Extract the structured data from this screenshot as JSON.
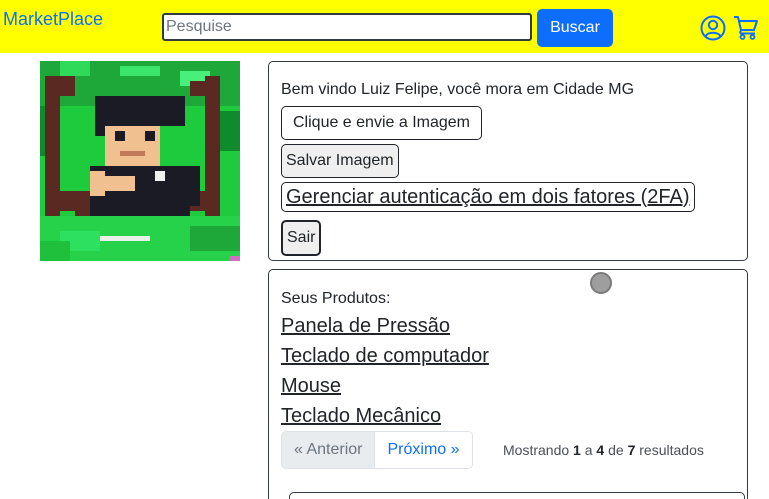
{
  "navbar": {
    "brand": "MarketPlace",
    "search_placeholder": "Pesquise",
    "search_button": "Buscar",
    "icons": [
      "user-circle-icon",
      "shopping-cart-icon"
    ],
    "accent_color": "#0d6efd",
    "background_color": "#ffff00"
  },
  "profile": {
    "welcome": "Bem vindo Luiz Felipe, você mora em Cidade MG",
    "upload_button": "Clique e envie a Imagem",
    "save_button": "Salvar Imagem",
    "twofa_button": "Gerenciar autenticação em dois fatores (2FA)",
    "logout_button": "Sair"
  },
  "products": {
    "title": "Seus Produtos:",
    "items": [
      "Panela de Pressão",
      "Teclado de computador",
      "Mouse",
      "Teclado Mecânico"
    ],
    "pagination": {
      "prev": "« Anterior",
      "next": "Próximo »",
      "prefix": "Mostrando",
      "from": "1",
      "a": "a",
      "to": "4",
      "de": "de",
      "total": "7",
      "suffix": "resultados"
    }
  }
}
